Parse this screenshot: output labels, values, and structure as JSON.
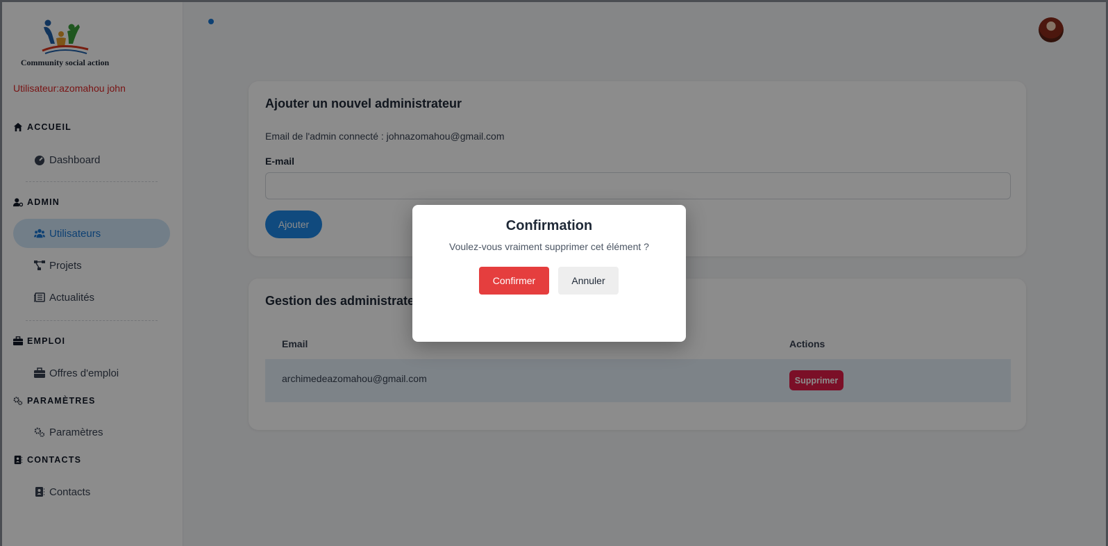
{
  "sidebar": {
    "logo_text": "Community social action",
    "user_line": "Utilisateur:azomahou john",
    "sections": [
      {
        "title": "ACCUEIL",
        "icon": "home-icon",
        "items": [
          {
            "label": "Dashboard",
            "icon": "gauge-icon"
          }
        ]
      },
      {
        "title": "ADMIN",
        "icon": "user-gear-icon",
        "items": [
          {
            "label": "Utilisateurs",
            "icon": "users-icon",
            "active": true
          },
          {
            "label": "Projets",
            "icon": "diagram-project-icon"
          },
          {
            "label": "Actualités",
            "icon": "newspaper-icon"
          }
        ]
      },
      {
        "title": "EMPLOI",
        "icon": "briefcase-icon",
        "items": [
          {
            "label": "Offres d'emploi",
            "icon": "briefcase-icon"
          }
        ]
      },
      {
        "title": "PARAMÈTRES",
        "icon": "gears-icon",
        "items": [
          {
            "label": "Paramètres",
            "icon": "gears-icon"
          }
        ]
      },
      {
        "title": "CONTACTS",
        "icon": "address-book-icon",
        "items": [
          {
            "label": "Contacts",
            "icon": "address-book-icon"
          }
        ]
      }
    ]
  },
  "add_admin": {
    "title": "Ajouter un nouvel administrateur",
    "connected_email": "Email de l'admin connecté : johnazomahou@gmail.com",
    "email_label": "E-mail",
    "email_value": "",
    "add_button": "Ajouter"
  },
  "manage": {
    "title": "Gestion des administrateurs",
    "columns": [
      "Email",
      "Actions"
    ],
    "rows": [
      {
        "email": "archimedeazomahou@gmail.com",
        "action": "Supprimer"
      }
    ]
  },
  "modal": {
    "title": "Confirmation",
    "message": "Voulez-vous vraiment supprimer cet élément ?",
    "confirm": "Confirmer",
    "cancel": "Annuler"
  },
  "colors": {
    "accent": "#1e88e5",
    "danger": "#e53e3e",
    "user_text": "#dc2626"
  }
}
